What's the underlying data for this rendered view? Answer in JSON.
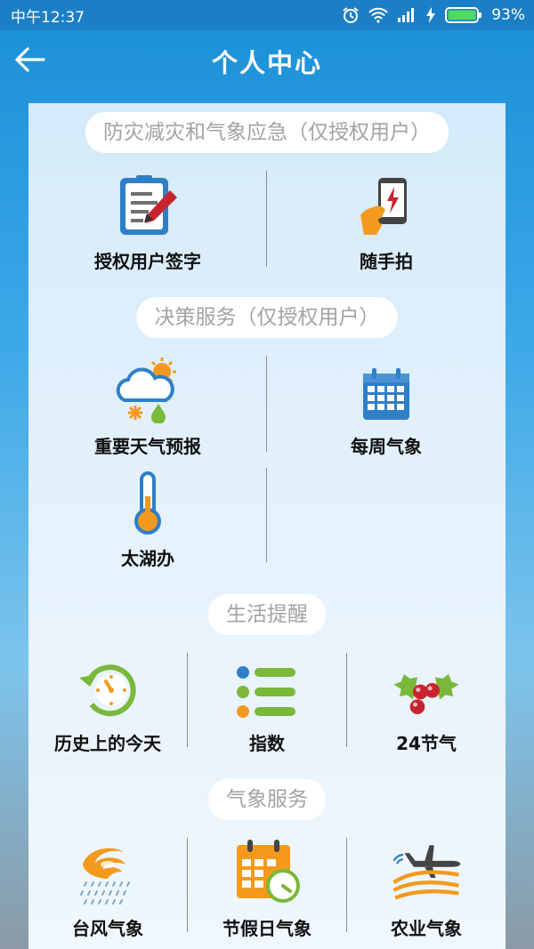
{
  "status": {
    "time": "中午12:37",
    "battery": "93%"
  },
  "header": {
    "title": "个人中心"
  },
  "sections": [
    {
      "title": "防灾减灾和气象应急（仅授权用户）",
      "items": [
        {
          "label": "授权用户签字",
          "icon": "signature-pen-icon"
        },
        {
          "label": "随手拍",
          "icon": "phone-snapshot-icon"
        }
      ]
    },
    {
      "title": "决策服务（仅授权用户）",
      "items": [
        {
          "label": "重要天气预报",
          "icon": "weather-cloud-sun-icon"
        },
        {
          "label": "每周气象",
          "icon": "calendar-icon"
        },
        {
          "label": "太湖办",
          "icon": "thermometer-icon"
        }
      ]
    },
    {
      "title": "生活提醒",
      "items": [
        {
          "label": "历史上的今天",
          "icon": "history-clock-icon"
        },
        {
          "label": "指数",
          "icon": "index-list-icon"
        },
        {
          "label": "24节气",
          "icon": "holly-berries-icon"
        }
      ]
    },
    {
      "title": "气象服务",
      "items": [
        {
          "label": "台风气象",
          "icon": "typhoon-icon"
        },
        {
          "label": "节假日气象",
          "icon": "holiday-calendar-icon"
        },
        {
          "label": "农业气象",
          "icon": "agriculture-plane-icon"
        }
      ]
    }
  ],
  "colors": {
    "statusbar": "#1c7fc5",
    "accent_orange": "#f39a1e",
    "accent_blue": "#2f7fc7",
    "accent_green": "#7ab83a",
    "accent_red": "#c8242f"
  }
}
